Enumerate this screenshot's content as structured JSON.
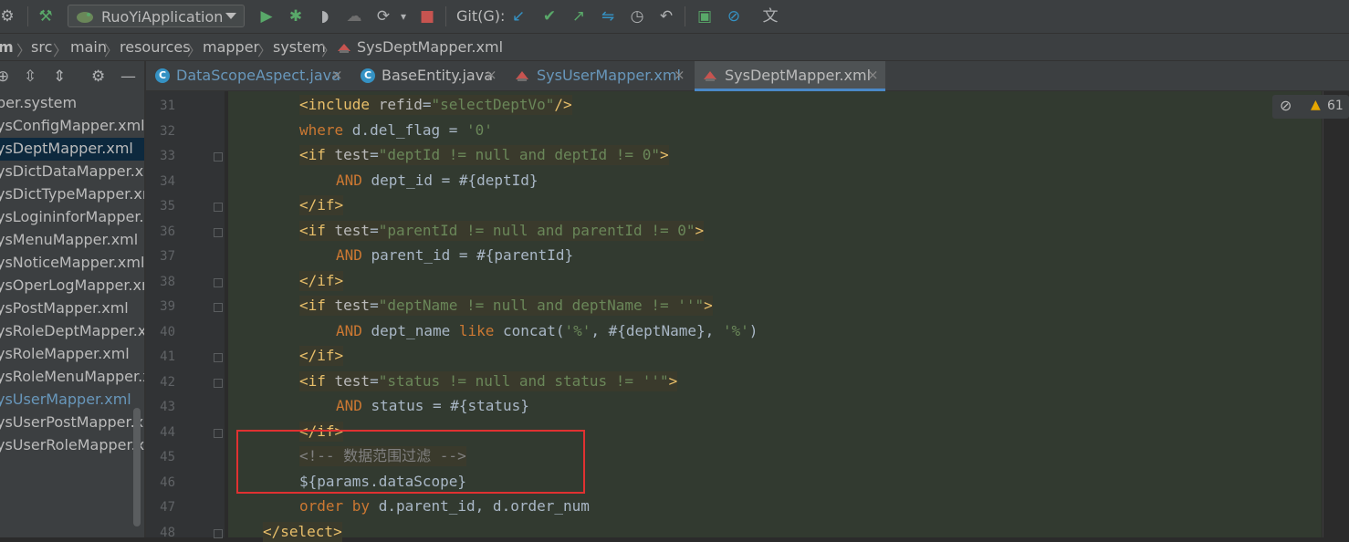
{
  "toolbar": {
    "run_config": "RuoYiApplication",
    "git_label": "Git(G):",
    "colors": {
      "run": "#59a869",
      "debug": "#59a869",
      "stop": "#c75450",
      "vcs_update": "#3592c4",
      "vcs_commit": "#59a869",
      "vcs_push": "#59a869"
    }
  },
  "breadcrumb": [
    "m",
    "src",
    "main",
    "resources",
    "mapper",
    "system",
    "SysDeptMapper.xml"
  ],
  "project_tree": {
    "items": [
      {
        "label": "per.system",
        "selected": false,
        "vcs": false
      },
      {
        "label": "ysConfigMapper.xml",
        "selected": false,
        "vcs": false
      },
      {
        "label": "ysDeptMapper.xml",
        "selected": true,
        "vcs": false
      },
      {
        "label": "ysDictDataMapper.xml",
        "selected": false,
        "vcs": false
      },
      {
        "label": "ysDictTypeMapper.xml",
        "selected": false,
        "vcs": false
      },
      {
        "label": "ysLogininforMapper.xml",
        "selected": false,
        "vcs": false
      },
      {
        "label": "ysMenuMapper.xml",
        "selected": false,
        "vcs": false
      },
      {
        "label": "ysNoticeMapper.xml",
        "selected": false,
        "vcs": false
      },
      {
        "label": "ysOperLogMapper.xml",
        "selected": false,
        "vcs": false
      },
      {
        "label": "ysPostMapper.xml",
        "selected": false,
        "vcs": false
      },
      {
        "label": "ysRoleDeptMapper.xml",
        "selected": false,
        "vcs": false
      },
      {
        "label": "ysRoleMapper.xml",
        "selected": false,
        "vcs": false
      },
      {
        "label": "ysRoleMenuMapper.xml",
        "selected": false,
        "vcs": false
      },
      {
        "label": "ysUserMapper.xml",
        "selected": false,
        "vcs": true
      },
      {
        "label": "ysUserPostMapper.xml",
        "selected": false,
        "vcs": false
      },
      {
        "label": "ysUserRoleMapper.xml",
        "selected": false,
        "vcs": false
      }
    ]
  },
  "tabs": [
    {
      "label": "DataScopeAspect.java",
      "kind": "java",
      "active": false,
      "vcs": true
    },
    {
      "label": "BaseEntity.java",
      "kind": "java",
      "active": false,
      "vcs": false
    },
    {
      "label": "SysUserMapper.xml",
      "kind": "xml",
      "active": false,
      "vcs": true
    },
    {
      "label": "SysDeptMapper.xml",
      "kind": "xml",
      "active": true,
      "vcs": false
    }
  ],
  "editor": {
    "line_numbers": [
      "31",
      "32",
      "33",
      "34",
      "35",
      "36",
      "37",
      "38",
      "39",
      "40",
      "41",
      "42",
      "43",
      "44",
      "45",
      "46",
      "47",
      "48"
    ],
    "lines": [
      {
        "indent": 2,
        "tokens": [
          [
            "tag",
            "<include "
          ],
          [
            "attr",
            "refid"
          ],
          [
            "plain",
            "="
          ],
          [
            "str",
            "\"selectDeptVo\""
          ],
          [
            "tag",
            "/>"
          ]
        ],
        "tagbg": true
      },
      {
        "indent": 2,
        "tokens": [
          [
            "kw",
            "where "
          ],
          [
            "plain",
            "d.del_flag = "
          ],
          [
            "str",
            "'0'"
          ]
        ],
        "tagbg": false
      },
      {
        "indent": 2,
        "tokens": [
          [
            "tag",
            "<if "
          ],
          [
            "attr",
            "test"
          ],
          [
            "plain",
            "="
          ],
          [
            "str",
            "\"deptId != null and deptId != 0\""
          ],
          [
            "tag",
            ">"
          ]
        ],
        "tagbg": true
      },
      {
        "indent": 3,
        "tokens": [
          [
            "kw",
            "AND "
          ],
          [
            "plain",
            "dept_id = #{deptId}"
          ]
        ],
        "tagbg": false
      },
      {
        "indent": 2,
        "tokens": [
          [
            "tag",
            "</if>"
          ]
        ],
        "tagbg": true
      },
      {
        "indent": 2,
        "tokens": [
          [
            "tag",
            "<if "
          ],
          [
            "attr",
            "test"
          ],
          [
            "plain",
            "="
          ],
          [
            "str",
            "\"parentId != null and parentId != 0\""
          ],
          [
            "tag",
            ">"
          ]
        ],
        "tagbg": true
      },
      {
        "indent": 3,
        "tokens": [
          [
            "kw",
            "AND "
          ],
          [
            "plain",
            "parent_id = #{parentId}"
          ]
        ],
        "tagbg": false
      },
      {
        "indent": 2,
        "tokens": [
          [
            "tag",
            "</if>"
          ]
        ],
        "tagbg": true
      },
      {
        "indent": 2,
        "tokens": [
          [
            "tag",
            "<if "
          ],
          [
            "attr",
            "test"
          ],
          [
            "plain",
            "="
          ],
          [
            "str",
            "\"deptName != null and deptName != ''\""
          ],
          [
            "tag",
            ">"
          ]
        ],
        "tagbg": true
      },
      {
        "indent": 3,
        "tokens": [
          [
            "kw",
            "AND "
          ],
          [
            "plain",
            "dept_name "
          ],
          [
            "kw",
            "like "
          ],
          [
            "plain",
            "concat("
          ],
          [
            "str",
            "'%'"
          ],
          [
            "plain",
            ", #{deptName}, "
          ],
          [
            "str",
            "'%'"
          ],
          [
            "plain",
            ")"
          ]
        ],
        "tagbg": false
      },
      {
        "indent": 2,
        "tokens": [
          [
            "tag",
            "</if>"
          ]
        ],
        "tagbg": true
      },
      {
        "indent": 2,
        "tokens": [
          [
            "tag",
            "<if "
          ],
          [
            "attr",
            "test"
          ],
          [
            "plain",
            "="
          ],
          [
            "str",
            "\"status != null and status != ''\""
          ],
          [
            "tag",
            ">"
          ]
        ],
        "tagbg": true
      },
      {
        "indent": 3,
        "tokens": [
          [
            "kw",
            "AND "
          ],
          [
            "plain",
            "status = #{status}"
          ]
        ],
        "tagbg": false
      },
      {
        "indent": 2,
        "tokens": [
          [
            "tag",
            "</if>"
          ]
        ],
        "tagbg": true
      },
      {
        "indent": 2,
        "tokens": [
          [
            "cmt",
            "<!-- 数据范围过滤 -->"
          ]
        ],
        "tagbg": true
      },
      {
        "indent": 2,
        "tokens": [
          [
            "plain",
            "${params.dataScope}"
          ]
        ],
        "tagbg": false
      },
      {
        "indent": 2,
        "tokens": [
          [
            "kw",
            "order by "
          ],
          [
            "plain",
            "d.parent_id, d.order_num"
          ]
        ],
        "tagbg": false
      },
      {
        "indent": 1,
        "tokens": [
          [
            "tag",
            "</select>"
          ]
        ],
        "tagbg": true
      }
    ],
    "folded_lines": [
      "33",
      "35",
      "36",
      "38",
      "39",
      "41",
      "42",
      "44",
      "48"
    ]
  },
  "inspection": {
    "warning_count": "61"
  },
  "colors": {
    "highlight_box": "#e03131",
    "selection": "#0d293e",
    "tab_underline": "#4a88c7"
  }
}
